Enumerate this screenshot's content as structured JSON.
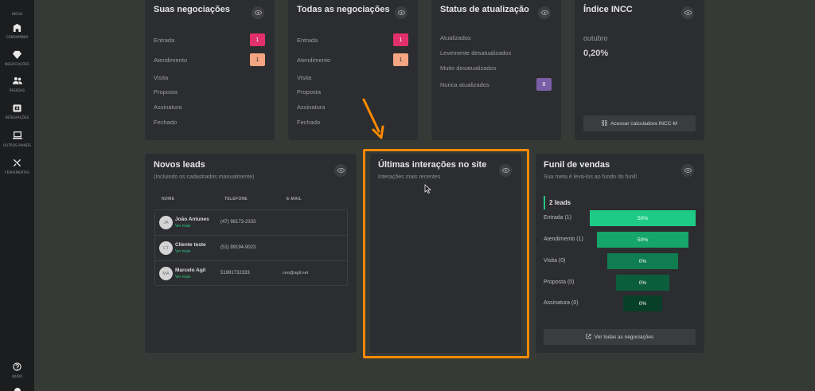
{
  "sidebar": {
    "items": [
      {
        "label": "Início",
        "icon": "home-icon"
      },
      {
        "label": "Condomínio",
        "icon": "building-icon"
      },
      {
        "label": "Negociações",
        "icon": "diamond-icon"
      },
      {
        "label": "Pessoas",
        "icon": "people-icon"
      },
      {
        "label": "Integrações",
        "icon": "integration-icon"
      },
      {
        "label": "Outros painéis",
        "icon": "laptop-icon"
      },
      {
        "label": "Ferramentas",
        "icon": "tools-icon"
      }
    ],
    "help_label": "Ajuda"
  },
  "suas": {
    "title": "Suas negociações",
    "rows": [
      {
        "label": "Entrada",
        "count": "1"
      },
      {
        "label": "Atendimento",
        "count": "1"
      },
      {
        "label": "Visita"
      },
      {
        "label": "Proposta"
      },
      {
        "label": "Assinatura"
      },
      {
        "label": "Fechado"
      }
    ]
  },
  "todas": {
    "title": "Todas as negociações",
    "rows": [
      {
        "label": "Entrada",
        "count": "1"
      },
      {
        "label": "Atendimento",
        "count": "1"
      },
      {
        "label": "Visita"
      },
      {
        "label": "Proposta"
      },
      {
        "label": "Assinatura"
      },
      {
        "label": "Fechado"
      }
    ]
  },
  "status": {
    "title": "Status de atualização",
    "rows": [
      {
        "label": "Atualizados"
      },
      {
        "label": "Levemente desatualizados"
      },
      {
        "label": "Muito desatualizados"
      },
      {
        "label": "Nunca atualizados",
        "count": "6"
      }
    ]
  },
  "incc": {
    "title": "Índice INCC",
    "month": "outubro",
    "value": "0,20%",
    "button": "Acessar calculadora INCC-M"
  },
  "leads": {
    "title": "Novos leads",
    "subtitle": "(Incluindo os cadastrados manualmente)",
    "headers": {
      "name": "NOME",
      "phone": "TELEFONE",
      "email": "E-MAIL"
    },
    "link_label": "Ver mais",
    "rows": [
      {
        "initials": "JA",
        "name": "João Antunes",
        "phone": "(47) 98173-2333",
        "email": ""
      },
      {
        "initials": "CT",
        "name": "Cliente teste",
        "phone": "(51) 99194-9023",
        "email": ""
      },
      {
        "initials": "MA",
        "name": "Marcelo Agil",
        "phone": "51981732333",
        "email": "ceo@agil.net"
      }
    ]
  },
  "interacoes": {
    "title": "Últimas interações no site",
    "subtitle": "Interações mais recentes"
  },
  "funil": {
    "title": "Funil de vendas",
    "subtitle": "Sua meta é levá-los ao fundo do funil!",
    "leads_count": "2 leads",
    "stages": [
      {
        "label": "Entrada (1)",
        "percent": "50%",
        "color": "#1ecb86"
      },
      {
        "label": "Atendimento (1)",
        "percent": "50%",
        "color": "#16a56a"
      },
      {
        "label": "Visita (0)",
        "percent": "0%",
        "color": "#0f7d50"
      },
      {
        "label": "Proposta (0)",
        "percent": "0%",
        "color": "#0b5e3c"
      },
      {
        "label": "Assinatura (0)",
        "percent": "0%",
        "color": "#083f29"
      }
    ],
    "button": "Ver todas as negociações"
  },
  "colors": {
    "accent": "#22c77f",
    "highlight": "#ff8a00"
  }
}
